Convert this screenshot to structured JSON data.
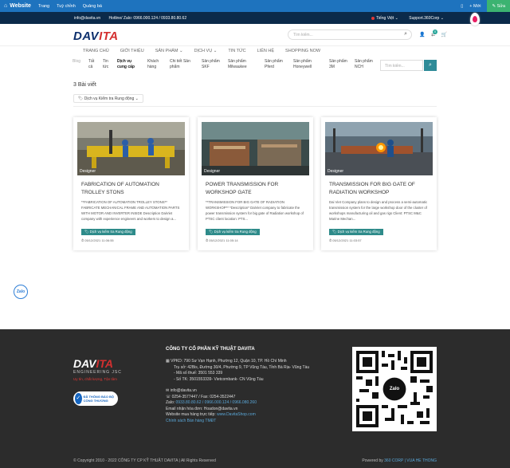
{
  "adminbar": {
    "site": "Website",
    "links": [
      "Trang",
      "Tuỳ chỉnh",
      "Quảng bá"
    ],
    "right": [
      "▯",
      "+ Mới"
    ],
    "edit": "✎ Sửa"
  },
  "topbar": {
    "email": "info@davita.vn",
    "hotline": "Hotline/ Zalo: 0966.000.124 / 0933.80.80.62",
    "lang": "Tiếng Việt",
    "support": "Support.360Corp"
  },
  "header": {
    "logo_a": "DAV",
    "logo_b": "ITA",
    "search_placeholder": "Tìm kiếm...",
    "cart_count": "0"
  },
  "nav": [
    "TRANG CHỦ",
    "GIỚI THIỆU",
    "SẢN PHẨM ⌄",
    "DỊCH VỤ ⌄",
    "TIN TỨC",
    "LIÊN HỆ",
    "SHOPPING NOW"
  ],
  "subnav": {
    "label": "Blog",
    "items": [
      "Tất cả",
      "Tin tức",
      "Dịch vụ cung cấp",
      "Khách hàng",
      "Chi tiết Sản phẩm",
      "Sản phẩm SKF",
      "Sản phẩm Milwaukee",
      "Sản phẩm Pferd",
      "Sản phẩm Honeywell",
      "Sản phẩm 3M",
      "Sản phẩm NCH"
    ],
    "search_placeholder": "Tìm kiếm..."
  },
  "listing": {
    "count": "3 Bài viết",
    "filter": "Dịch vụ Kiểm tra Rung động"
  },
  "posts": [
    {
      "tag": "Designer",
      "title": "FABRICATION OF AUTOMATION TROLLEY STONS",
      "excerpt": "**FABRICATION OF AUTOMATION TROLLEY STONS** FABRICATE MECHANICAL FRAME AND AUTOMATION PARTS WITH MOTOR AND INVERTER INSIDE Description DaiViet company with experience engineers and workers to design a...",
      "more": "Dịch vụ kiểm tra Rung động",
      "date": "05/12/2021 11:06:55"
    },
    {
      "tag": "Designer",
      "title": "POWER TRANSMISSION FOR WORKSHOP GATE",
      "excerpt": "**TRANSMISSION FOR BIG GATE OF RADIATION WORKSHOP** *Description* DaiViet company to fabricate the power transmission system for big gate of Radiation workshop of PTSC client location: PTS...",
      "more": "Dịch vụ kiểm tra Rung động",
      "date": "05/12/2021 11:05:14"
    },
    {
      "tag": "Designer",
      "title": "TRANSMISSION FOR BIG GATE OF RADIATION WORKSHOP",
      "excerpt": "Dai Viet Company plans to design and process a semi-automatic transmission system for the large workshop door of the cluster of workshops manufacturing oil and gas rigs Client: PTSC M&C Marine Mechan...",
      "more": "Dịch vụ kiểm tra Rung động",
      "date": "05/12/2021 11:03:57"
    }
  ],
  "zalo": "Zalo",
  "footer": {
    "logo_a": "DAV",
    "logo_b": "ITA",
    "sub": "ENGINEERING JSC",
    "red": "Uy tín, chất lượng, Tận tâm",
    "badge_mark": "✓",
    "badge": "ĐÃ THÔNG BÁO BỘ CÔNG THƯƠNG",
    "company": "CÔNG TY CỔ PHẦN KỸ THUẬT DAVITA",
    "addr1": "VPKD: 790 Sư Vạn Hạnh, Phường 12, Quận 10, TP. Hồ Chí Minh",
    "addr2": "Trụ sở: 42Bis, Đường 30/4, Phường 9, TP Vũng Tàu, Tỉnh Bà Rịa- Vũng Tàu",
    "tax": "- Mã số thuế: 3501 553 339",
    "bank": "- Số TK: 3501553339- Vietcombank- CN Vũng Tàu",
    "email": "info@davita.vn",
    "phone": "0254-3577447  /  Fax: 0254-3522447",
    "zalo_label": "Zalo: ",
    "zalo_nums": "0933.80.80.62  /  0966.000.124  /  0966.080.260",
    "orders": "Email nhận hóa đơn: Hoadon@davita.vn",
    "shop_label": "Website mua hàng trực tiếp: ",
    "shop": "www.DavitaShop.com",
    "policy": "Chính sách Bán hàng TMĐT",
    "qr_label": "Zalo",
    "copyright": "© Copyright 2010 - 2022 CÔNG TY CP KỸ THUẬT DAVITA | All Rights Reserved",
    "power_label": "Powered by ",
    "power": "360 CORP | VUA HE THONG"
  }
}
